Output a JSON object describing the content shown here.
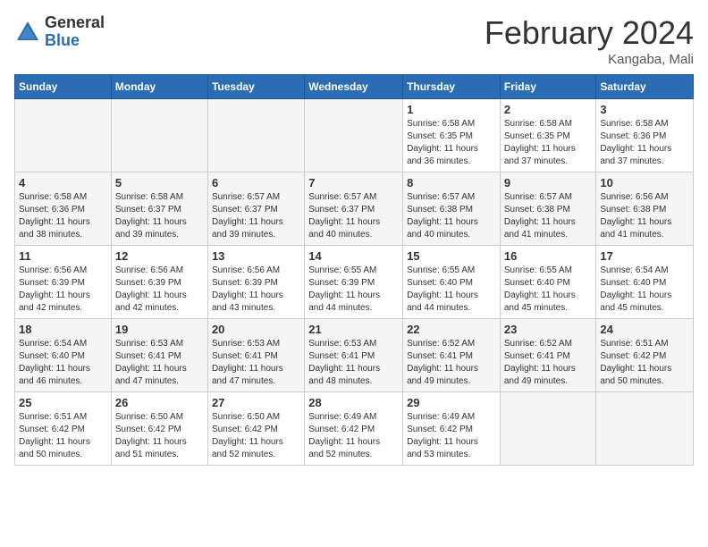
{
  "header": {
    "logo_general": "General",
    "logo_blue": "Blue",
    "month_title": "February 2024",
    "location": "Kangaba, Mali"
  },
  "columns": [
    "Sunday",
    "Monday",
    "Tuesday",
    "Wednesday",
    "Thursday",
    "Friday",
    "Saturday"
  ],
  "weeks": [
    {
      "days": [
        {
          "num": "",
          "info": ""
        },
        {
          "num": "",
          "info": ""
        },
        {
          "num": "",
          "info": ""
        },
        {
          "num": "",
          "info": ""
        },
        {
          "num": "1",
          "info": "Sunrise: 6:58 AM\nSunset: 6:35 PM\nDaylight: 11 hours\nand 36 minutes."
        },
        {
          "num": "2",
          "info": "Sunrise: 6:58 AM\nSunset: 6:35 PM\nDaylight: 11 hours\nand 37 minutes."
        },
        {
          "num": "3",
          "info": "Sunrise: 6:58 AM\nSunset: 6:36 PM\nDaylight: 11 hours\nand 37 minutes."
        }
      ]
    },
    {
      "days": [
        {
          "num": "4",
          "info": "Sunrise: 6:58 AM\nSunset: 6:36 PM\nDaylight: 11 hours\nand 38 minutes."
        },
        {
          "num": "5",
          "info": "Sunrise: 6:58 AM\nSunset: 6:37 PM\nDaylight: 11 hours\nand 39 minutes."
        },
        {
          "num": "6",
          "info": "Sunrise: 6:57 AM\nSunset: 6:37 PM\nDaylight: 11 hours\nand 39 minutes."
        },
        {
          "num": "7",
          "info": "Sunrise: 6:57 AM\nSunset: 6:37 PM\nDaylight: 11 hours\nand 40 minutes."
        },
        {
          "num": "8",
          "info": "Sunrise: 6:57 AM\nSunset: 6:38 PM\nDaylight: 11 hours\nand 40 minutes."
        },
        {
          "num": "9",
          "info": "Sunrise: 6:57 AM\nSunset: 6:38 PM\nDaylight: 11 hours\nand 41 minutes."
        },
        {
          "num": "10",
          "info": "Sunrise: 6:56 AM\nSunset: 6:38 PM\nDaylight: 11 hours\nand 41 minutes."
        }
      ]
    },
    {
      "days": [
        {
          "num": "11",
          "info": "Sunrise: 6:56 AM\nSunset: 6:39 PM\nDaylight: 11 hours\nand 42 minutes."
        },
        {
          "num": "12",
          "info": "Sunrise: 6:56 AM\nSunset: 6:39 PM\nDaylight: 11 hours\nand 42 minutes."
        },
        {
          "num": "13",
          "info": "Sunrise: 6:56 AM\nSunset: 6:39 PM\nDaylight: 11 hours\nand 43 minutes."
        },
        {
          "num": "14",
          "info": "Sunrise: 6:55 AM\nSunset: 6:39 PM\nDaylight: 11 hours\nand 44 minutes."
        },
        {
          "num": "15",
          "info": "Sunrise: 6:55 AM\nSunset: 6:40 PM\nDaylight: 11 hours\nand 44 minutes."
        },
        {
          "num": "16",
          "info": "Sunrise: 6:55 AM\nSunset: 6:40 PM\nDaylight: 11 hours\nand 45 minutes."
        },
        {
          "num": "17",
          "info": "Sunrise: 6:54 AM\nSunset: 6:40 PM\nDaylight: 11 hours\nand 45 minutes."
        }
      ]
    },
    {
      "days": [
        {
          "num": "18",
          "info": "Sunrise: 6:54 AM\nSunset: 6:40 PM\nDaylight: 11 hours\nand 46 minutes."
        },
        {
          "num": "19",
          "info": "Sunrise: 6:53 AM\nSunset: 6:41 PM\nDaylight: 11 hours\nand 47 minutes."
        },
        {
          "num": "20",
          "info": "Sunrise: 6:53 AM\nSunset: 6:41 PM\nDaylight: 11 hours\nand 47 minutes."
        },
        {
          "num": "21",
          "info": "Sunrise: 6:53 AM\nSunset: 6:41 PM\nDaylight: 11 hours\nand 48 minutes."
        },
        {
          "num": "22",
          "info": "Sunrise: 6:52 AM\nSunset: 6:41 PM\nDaylight: 11 hours\nand 49 minutes."
        },
        {
          "num": "23",
          "info": "Sunrise: 6:52 AM\nSunset: 6:41 PM\nDaylight: 11 hours\nand 49 minutes."
        },
        {
          "num": "24",
          "info": "Sunrise: 6:51 AM\nSunset: 6:42 PM\nDaylight: 11 hours\nand 50 minutes."
        }
      ]
    },
    {
      "days": [
        {
          "num": "25",
          "info": "Sunrise: 6:51 AM\nSunset: 6:42 PM\nDaylight: 11 hours\nand 50 minutes."
        },
        {
          "num": "26",
          "info": "Sunrise: 6:50 AM\nSunset: 6:42 PM\nDaylight: 11 hours\nand 51 minutes."
        },
        {
          "num": "27",
          "info": "Sunrise: 6:50 AM\nSunset: 6:42 PM\nDaylight: 11 hours\nand 52 minutes."
        },
        {
          "num": "28",
          "info": "Sunrise: 6:49 AM\nSunset: 6:42 PM\nDaylight: 11 hours\nand 52 minutes."
        },
        {
          "num": "29",
          "info": "Sunrise: 6:49 AM\nSunset: 6:42 PM\nDaylight: 11 hours\nand 53 minutes."
        },
        {
          "num": "",
          "info": ""
        },
        {
          "num": "",
          "info": ""
        }
      ]
    }
  ]
}
